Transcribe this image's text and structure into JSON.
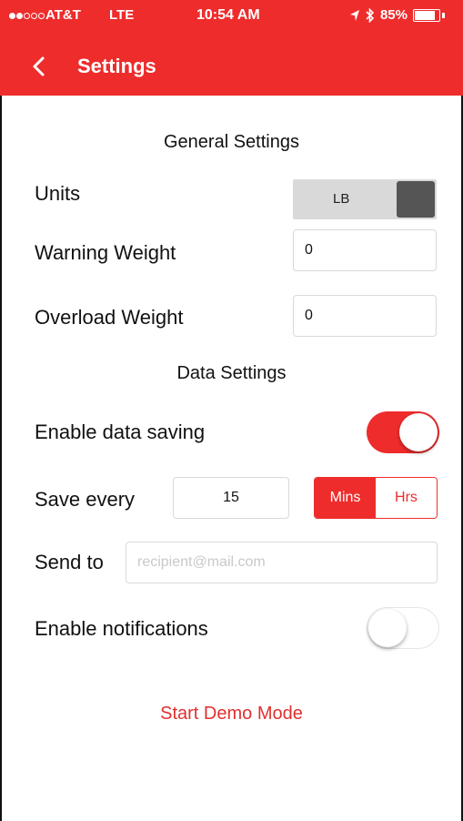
{
  "status_bar": {
    "carrier": "AT&T",
    "network": "LTE",
    "time": "10:54 AM",
    "battery": "85%"
  },
  "nav": {
    "title": "Settings"
  },
  "general": {
    "title": "General Settings",
    "units_label": "Units",
    "units_value": "LB",
    "warning_label": "Warning Weight",
    "warning_value": "0",
    "overload_label": "Overload Weight",
    "overload_value": "0"
  },
  "data": {
    "title": "Data Settings",
    "enable_saving_label": "Enable data saving",
    "enable_saving_on": true,
    "save_every_label": "Save every",
    "save_every_value": "15",
    "unit_options": [
      "Mins",
      "Hrs"
    ],
    "unit_selected": "Mins",
    "send_to_label": "Send to",
    "send_to_placeholder": "recipient@mail.com",
    "notifications_label": "Enable notifications",
    "notifications_on": false
  },
  "demo_button": "Start Demo Mode",
  "colors": {
    "accent": "#ee2c2c",
    "toggle_track": "#d9d9d9",
    "toggle_knob": "#555555"
  }
}
